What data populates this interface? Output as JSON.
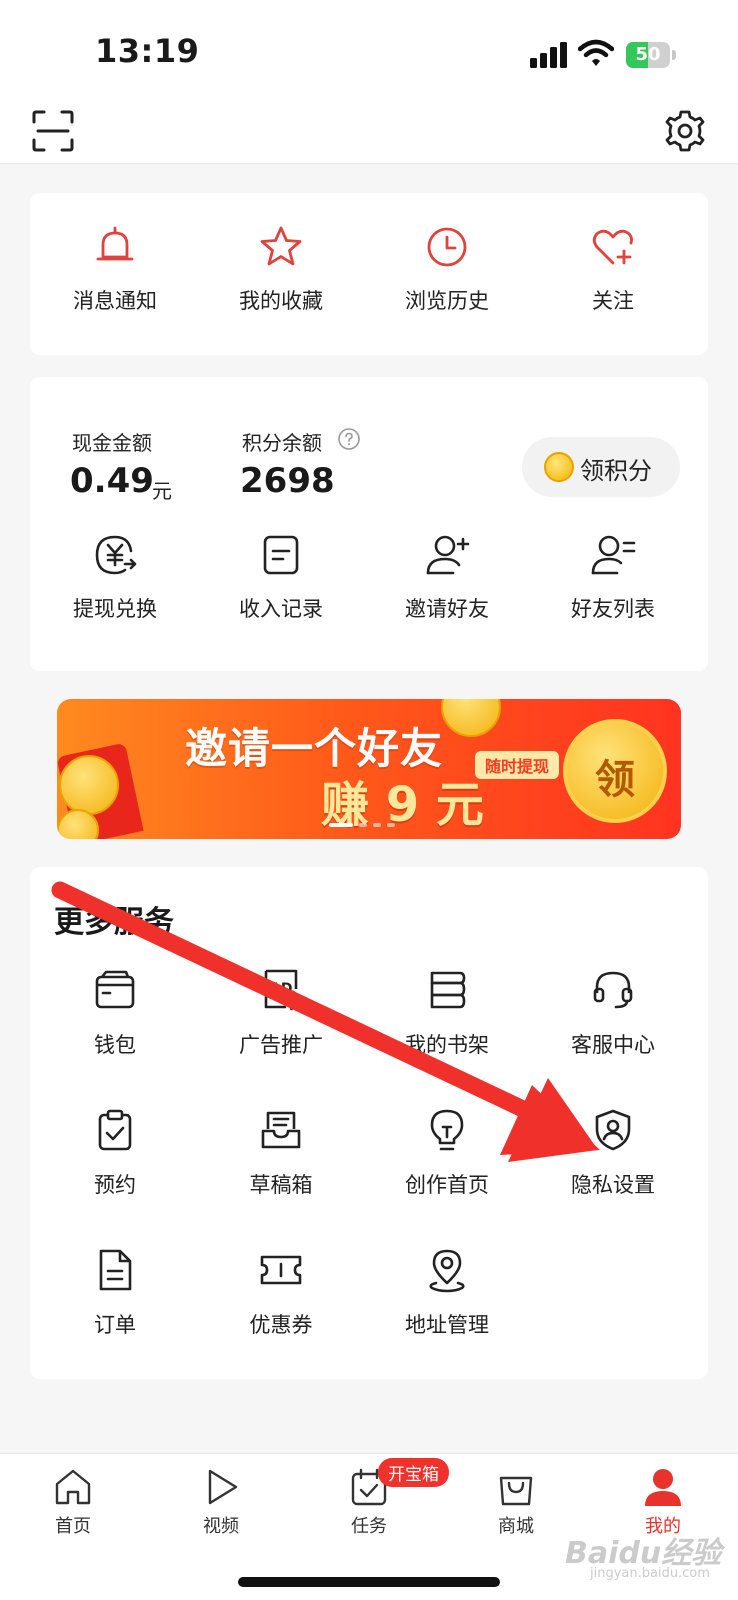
{
  "status_bar": {
    "time": "13:19",
    "battery": "50",
    "battery_level": 0.5
  },
  "quick_actions": [
    {
      "label": "消息通知",
      "icon": "bell-icon"
    },
    {
      "label": "我的收藏",
      "icon": "star-icon"
    },
    {
      "label": "浏览历史",
      "icon": "clock-icon"
    },
    {
      "label": "关注",
      "icon": "heart-plus-icon"
    }
  ],
  "wallet": {
    "cash_label": "现金金额",
    "cash_value": "0.49",
    "cash_unit": "元",
    "points_label": "积分余额",
    "points_value": "2698",
    "claim_points": "领积分",
    "actions": [
      {
        "label": "提现兑换",
        "icon": "yuan-exchange-icon"
      },
      {
        "label": "收入记录",
        "icon": "record-icon"
      },
      {
        "label": "邀请好友",
        "icon": "add-friend-icon"
      },
      {
        "label": "好友列表",
        "icon": "friend-list-icon"
      }
    ]
  },
  "banner": {
    "title": "邀请一个好友",
    "amount": "赚 9 元",
    "tag": "随时提现",
    "coin_label": "领"
  },
  "services": {
    "title": "更多服务",
    "items": [
      {
        "label": "钱包",
        "icon": "wallet-icon"
      },
      {
        "label": "广告推广",
        "icon": "ad-icon"
      },
      {
        "label": "我的书架",
        "icon": "bookshelf-icon"
      },
      {
        "label": "客服中心",
        "icon": "headset-icon"
      },
      {
        "label": "预约",
        "icon": "clipboard-check-icon"
      },
      {
        "label": "草稿箱",
        "icon": "draft-box-icon"
      },
      {
        "label": "创作首页",
        "icon": "lightbulb-icon"
      },
      {
        "label": "隐私设置",
        "icon": "shield-user-icon"
      },
      {
        "label": "订单",
        "icon": "document-icon"
      },
      {
        "label": "优惠券",
        "icon": "coupon-icon"
      },
      {
        "label": "地址管理",
        "icon": "location-pin-icon"
      }
    ]
  },
  "tabs": [
    {
      "label": "首页",
      "icon": "home-icon"
    },
    {
      "label": "视频",
      "icon": "play-icon"
    },
    {
      "label": "任务",
      "icon": "task-icon",
      "badge": "开宝箱"
    },
    {
      "label": "商城",
      "icon": "shopping-bag-icon"
    },
    {
      "label": "我的",
      "icon": "user-icon",
      "active": true
    }
  ],
  "colors": {
    "accent_red": "#e8332c",
    "icon_red": "#e0433e",
    "arrow_red": "#f0302a"
  },
  "watermark": {
    "text": "Baidu经验",
    "sub": "jingyan.baidu.com"
  }
}
